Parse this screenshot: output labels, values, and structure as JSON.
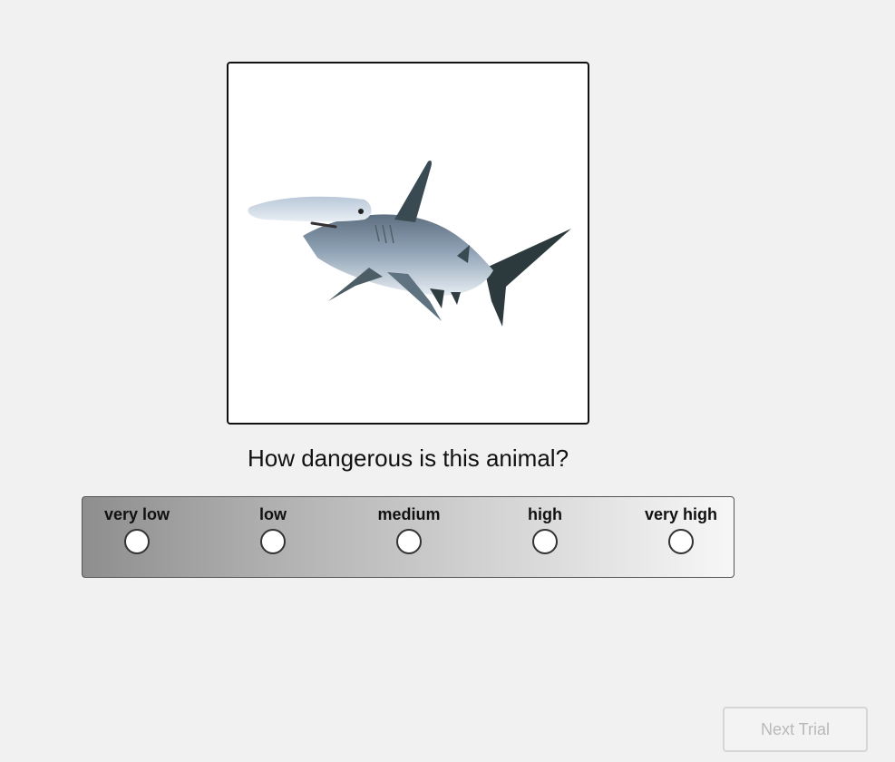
{
  "stimulus": {
    "image_subject": "hammerhead-shark"
  },
  "question": "How dangerous is this animal?",
  "scale": {
    "options": [
      {
        "label": "very low",
        "selected": false
      },
      {
        "label": "low",
        "selected": false
      },
      {
        "label": "medium",
        "selected": false
      },
      {
        "label": "high",
        "selected": false
      },
      {
        "label": "very high",
        "selected": false
      }
    ],
    "gradient_colors": [
      "#8e8e8e",
      "#f7f7f7"
    ]
  },
  "next_button": {
    "label": "Next Trial",
    "enabled": false
  }
}
